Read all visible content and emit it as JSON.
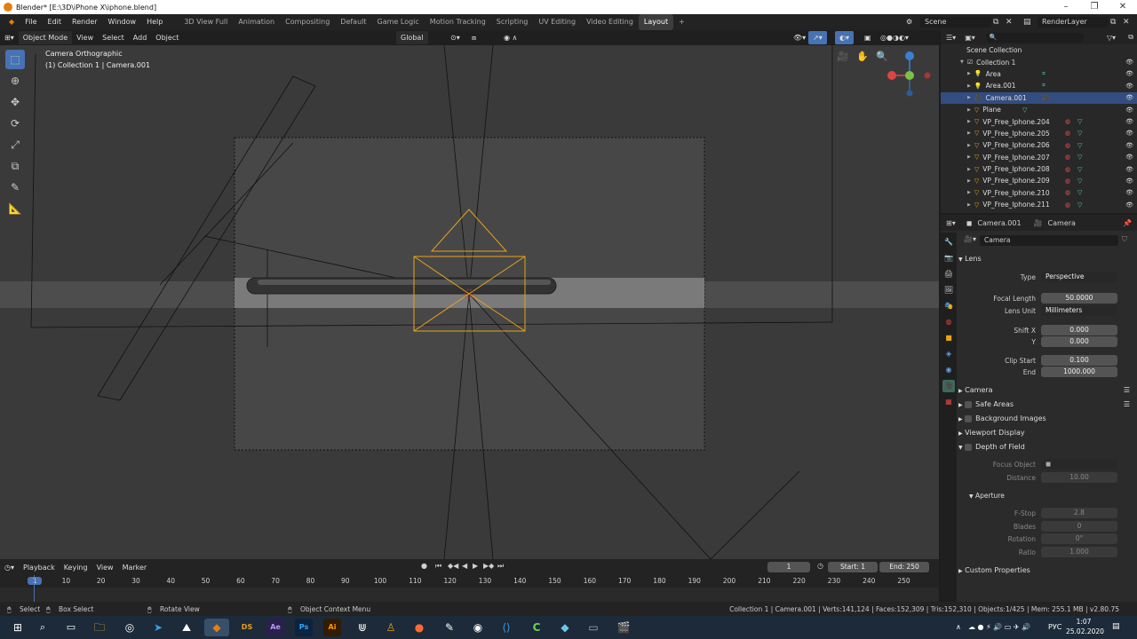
{
  "window": {
    "title": "Blender* [E:\\3D\\iPhone X\\iphone.blend]"
  },
  "menus": [
    "File",
    "Edit",
    "Render",
    "Window",
    "Help"
  ],
  "workspaces": [
    {
      "label": "3D View Full",
      "active": false
    },
    {
      "label": "Animation",
      "active": false
    },
    {
      "label": "Compositing",
      "active": false
    },
    {
      "label": "Default",
      "active": false
    },
    {
      "label": "Game Logic",
      "active": false
    },
    {
      "label": "Motion Tracking",
      "active": false
    },
    {
      "label": "Scripting",
      "active": false
    },
    {
      "label": "UV Editing",
      "active": false
    },
    {
      "label": "Video Editing",
      "active": false
    },
    {
      "label": "Layout",
      "active": true
    }
  ],
  "scene": {
    "name": "Scene",
    "render_layer": "RenderLayer"
  },
  "viewport_header": {
    "mode": "Object Mode",
    "view": "View",
    "select": "Select",
    "add": "Add",
    "object": "Object",
    "orientation": "Global"
  },
  "viewport_overlay": {
    "title": "Camera Orthographic",
    "subtitle": "(1) Collection 1 | Camera.001"
  },
  "outliner": {
    "root": "Scene Collection",
    "rows": [
      {
        "label": "Collection 1",
        "kind": "collection",
        "selected": false
      },
      {
        "label": "Area",
        "kind": "light",
        "selected": false
      },
      {
        "label": "Area.001",
        "kind": "light",
        "selected": false
      },
      {
        "label": "Camera.001",
        "kind": "camera",
        "selected": true
      },
      {
        "label": "Plane",
        "kind": "mesh",
        "selected": false
      },
      {
        "label": "VP_Free_Iphone.204",
        "kind": "mesh",
        "selected": false
      },
      {
        "label": "VP_Free_Iphone.205",
        "kind": "mesh",
        "selected": false
      },
      {
        "label": "VP_Free_Iphone.206",
        "kind": "mesh",
        "selected": false
      },
      {
        "label": "VP_Free_Iphone.207",
        "kind": "mesh",
        "selected": false
      },
      {
        "label": "VP_Free_Iphone.208",
        "kind": "mesh",
        "selected": false
      },
      {
        "label": "VP_Free_Iphone.209",
        "kind": "mesh",
        "selected": false
      },
      {
        "label": "VP_Free_Iphone.210",
        "kind": "mesh",
        "selected": false
      },
      {
        "label": "VP_Free_Iphone.211",
        "kind": "mesh",
        "selected": false
      }
    ]
  },
  "properties": {
    "object_name": "Camera.001",
    "data_label": "Camera",
    "datablock": "Camera",
    "lens_section": "Lens",
    "type_label": "Type",
    "type_value": "Perspective",
    "focal_length_label": "Focal Length",
    "focal_length": "50.0000",
    "lens_unit_label": "Lens Unit",
    "lens_unit": "Millimeters",
    "shift_x_label": "Shift X",
    "shift_x": "0.000",
    "shift_y_label": "Y",
    "shift_y": "0.000",
    "clip_start_label": "Clip Start",
    "clip_start": "0.100",
    "clip_end_label": "End",
    "clip_end": "1000.000",
    "camera_section": "Camera",
    "safe_areas": "Safe Areas",
    "background_images": "Background Images",
    "viewport_display": "Viewport Display",
    "dof": "Depth of Field",
    "focus_object_label": "Focus Object",
    "distance_label": "Distance",
    "distance": "10.00",
    "aperture": "Aperture",
    "fstop_label": "F-Stop",
    "fstop": "2.8",
    "blades_label": "Blades",
    "blades": "0",
    "rotation_label": "Rotation",
    "rotation": "0°",
    "ratio_label": "Ratio",
    "ratio": "1.000",
    "custom_props": "Custom Properties"
  },
  "timeline": {
    "menus": [
      "Playback",
      "Keying",
      "View",
      "Marker"
    ],
    "current_frame": "1",
    "start_label": "Start:",
    "start": "1",
    "end_label": "End:",
    "end": "250",
    "ruler": [
      "1",
      "10",
      "20",
      "30",
      "40",
      "50",
      "60",
      "70",
      "80",
      "90",
      "100",
      "110",
      "120",
      "130",
      "140",
      "150",
      "160",
      "170",
      "180",
      "190",
      "200",
      "210",
      "220",
      "230",
      "240",
      "250"
    ]
  },
  "statusbar": {
    "select": "Select",
    "box_select": "Box Select",
    "rotate_view": "Rotate View",
    "context_menu": "Object Context Menu",
    "stats": "Collection 1 | Camera.001 | Verts:141,124 | Faces:152,309 | Tris:152,310 | Objects:1/425 | Mem: 255.1 MB | v2.80.75"
  },
  "taskbar": {
    "lang": "РУС",
    "time": "1:07",
    "date": "25.02.2020"
  }
}
